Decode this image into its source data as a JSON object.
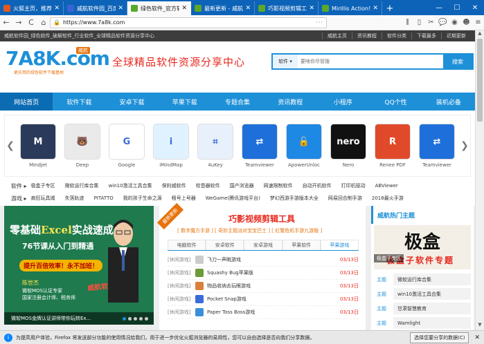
{
  "tabs": [
    {
      "title": "火狐主页，推荐使用",
      "color": "#e25822"
    },
    {
      "title": "威航软件园_百度搜索",
      "color": "#3c63d6"
    },
    {
      "title": "绿色软件_官方软件下载",
      "color": "#5ba829",
      "active": true
    },
    {
      "title": "最新更新 - 威航软件园",
      "color": "#5ba829"
    },
    {
      "title": "巧影视频剪辑工具",
      "color": "#5ba829"
    },
    {
      "title": "Mirillis Action! (官方",
      "color": "#5ba829"
    }
  ],
  "new_tab": "+",
  "window_buttons": {
    "min": "—",
    "max": "☐",
    "close": "✕"
  },
  "nav": {
    "back": "←",
    "forward": "→",
    "reload": "C",
    "home": "⌂",
    "url": "https://www.7a8k.com",
    "page_actions": "···"
  },
  "site": {
    "topstrip_text": "威航软件园_绿色软件_破解软件_行业软件_全球精品软件资源分享中心",
    "topstrip_links": [
      "威航主页",
      "资讯教程",
      "软件分类",
      "下载最多",
      "近期更新"
    ],
    "logo": "7A8K.com",
    "logo_badge": "威航",
    "logo_sub": "更实用的绿色软件下载基地",
    "slogan": "全球精品软件资源分享中心",
    "search": {
      "category": "软件 ▾",
      "placeholder": "要啥你尽管搜",
      "button": "搜索"
    },
    "mainnav": [
      "网站首页",
      "软件下载",
      "安卓下载",
      "苹果下载",
      "专题合集",
      "资讯教程",
      "小程序",
      "QQ个性",
      "装机必备"
    ],
    "arrow_left": "❮",
    "arrow_right": "❯",
    "apps": [
      {
        "name": "Mindjet",
        "color": "#2a3a5a",
        "glyph": "M"
      },
      {
        "name": "Deep",
        "color": "#eaeaea",
        "glyph": "🐻"
      },
      {
        "name": "Google",
        "color": "#ffffff",
        "glyph": "G"
      },
      {
        "name": "iMindMap",
        "color": "#e0f2ff",
        "glyph": "i"
      },
      {
        "name": "4uKey",
        "color": "#e8f0fb",
        "glyph": "⌗"
      },
      {
        "name": "Teamviewer",
        "color": "#1e6fd9",
        "glyph": "⇄"
      },
      {
        "name": "ApowerUnloc",
        "color": "#1e88e5",
        "glyph": "🔓"
      },
      {
        "name": "Nero",
        "color": "#111111",
        "glyph": "nero"
      },
      {
        "name": "Renee PDF",
        "color": "#e04a2a",
        "glyph": "R"
      },
      {
        "name": "Teamviewer",
        "color": "#1e6fd9",
        "glyph": "⇄"
      }
    ],
    "soft_row": {
      "head": "软件 ▸",
      "items": [
        "极盒子专区",
        "微软运行库合集",
        "win10激活工具合集",
        "保利威软件",
        "校音器软件",
        "国产浏览器",
        "网速限制软件",
        "自动开机软件",
        "打印机驱动",
        "ABViewer"
      ]
    },
    "game_row": {
      "head": "游戏 ▸",
      "items": [
        "疯狂玩具城",
        "失落轨迹",
        "PITATTO",
        "我的孩子生命之源",
        "租号上号器",
        "WeGame(腾讯游戏平台)",
        "梦幻西游手游版本大全",
        "网易回合制手游",
        "2018最火手游"
      ]
    },
    "banner": {
      "t1a": "零基础",
      "t1b": "Excel",
      "t1c": "实战速成",
      "t2": "76节课从入门到精通",
      "t3": "提升百倍效率！永不加班！",
      "t4": "陈世杰",
      "t5": "微软MOS认证专家",
      "t6": "国家注册会计师、税务师",
      "t7": "威航软件园",
      "caption": "微软MOS金牌认证讲师带你玩转Ex...",
      "dots": 5
    },
    "center": {
      "ribbon": "最新更新",
      "title": "巧影视频剪辑工具",
      "subtitle": "[ 数字魔方手游 ] [ 奇妙主题派对宝宝巴士 ] [ 红警危机手游九游版 ]",
      "tabs": [
        "电脑软件",
        "安卓软件",
        "安卓游戏",
        "苹果软件",
        "苹果游戏"
      ],
      "rows": [
        {
          "tag": "[休闲游戏]",
          "name": "飞刀一声眺游戏",
          "date": "03/13日",
          "color": "#ccc"
        },
        {
          "tag": "[休闲游戏]",
          "name": "Squashy Bug苹果版",
          "date": "03/13日",
          "color": "#6b9b3a"
        },
        {
          "tag": "[休闲游戏]",
          "name": "物品收纳去玩眼游戏",
          "date": "03/13日",
          "color": "#d9803a"
        },
        {
          "tag": "[休闲游戏]",
          "name": "Pocket Snap游戏",
          "date": "03/13日",
          "color": "#3a6bd9"
        },
        {
          "tag": "[休闲游戏]",
          "name": "Paper Toss Boss游戏",
          "date": "03/13日",
          "color": "#3a8fd9"
        }
      ]
    },
    "right": {
      "head": "威航热门主题",
      "banner_big": "极盒",
      "banner_red": "极盒子软件专题",
      "banner_cap": "极盒子专区",
      "rows": [
        {
          "tag": "主题",
          "name": "微软运行库合集"
        },
        {
          "tag": "主题",
          "name": "win10激活工具合集"
        },
        {
          "tag": "主题",
          "name": "甘肃智慧教育"
        },
        {
          "tag": "主题",
          "name": "Wamlight"
        }
      ]
    }
  },
  "notification": {
    "icon": "i",
    "text": "为提高用户体验，Firefox 将发送部分功能的使用情况给我们，用于进一步优化火狐浏览器的易用性，您可以自由选择是否向我们分享数据。",
    "button": "选择您要分享的数据(C)",
    "close": "✕"
  }
}
